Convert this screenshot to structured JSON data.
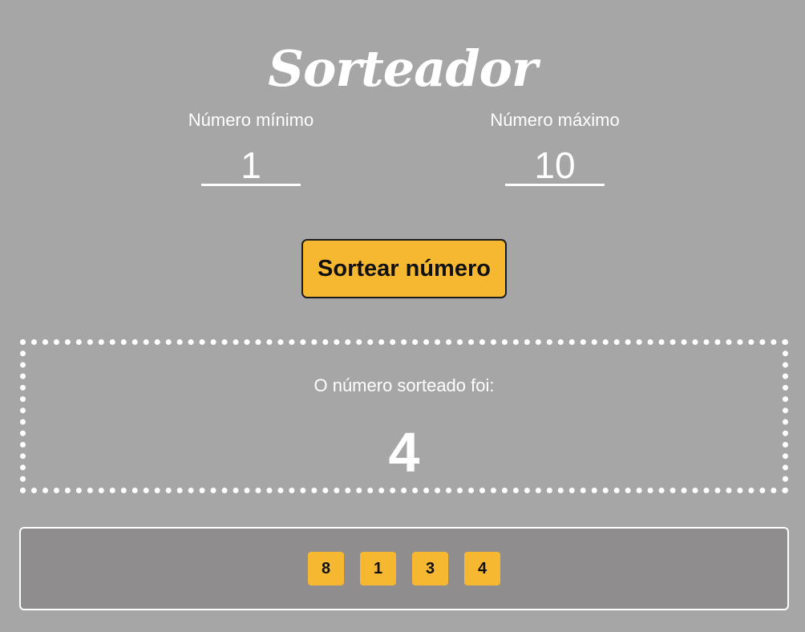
{
  "app": {
    "title": "Sorteador"
  },
  "form": {
    "min_label": "Número mínimo",
    "min_value": "1",
    "max_label": "Número máximo",
    "max_value": "10",
    "draw_button_label": "Sortear número"
  },
  "result": {
    "label": "O número sorteado foi:",
    "value": "4"
  },
  "history": {
    "items": [
      "8",
      "1",
      "3",
      "4"
    ]
  },
  "colors": {
    "background": "#a6a6a6",
    "accent": "#f6b830",
    "history_background": "#8f8d8e",
    "text": "#ffffff"
  }
}
